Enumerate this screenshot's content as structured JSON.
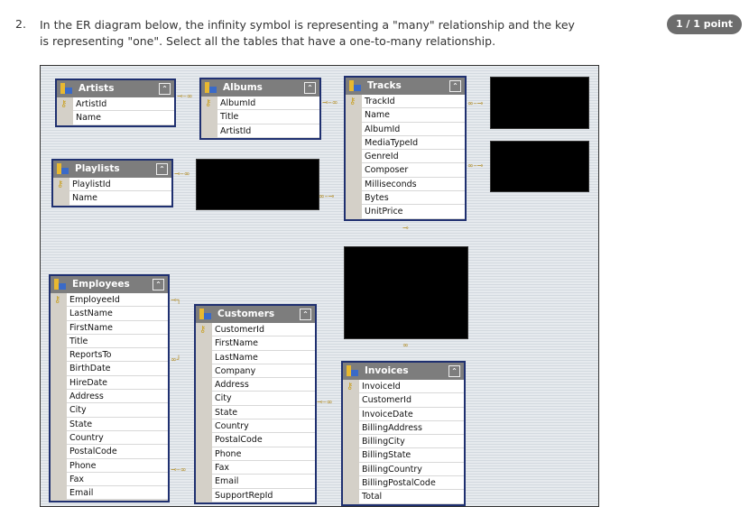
{
  "question": {
    "number": "2.",
    "text": "In the ER diagram below, the infinity symbol is representing a \"many\" relationship and the key is representing \"one\". Select all the tables that have a one-to-many relationship.",
    "score": "1 / 1 point"
  },
  "tables": {
    "artists": {
      "title": "Artists",
      "fields": [
        "ArtistId",
        "Name"
      ]
    },
    "albums": {
      "title": "Albums",
      "fields": [
        "AlbumId",
        "Title",
        "ArtistId"
      ]
    },
    "tracks": {
      "title": "Tracks",
      "fields": [
        "TrackId",
        "Name",
        "AlbumId",
        "MediaTypeId",
        "GenreId",
        "Composer",
        "Milliseconds",
        "Bytes",
        "UnitPrice"
      ]
    },
    "playlists": {
      "title": "Playlists",
      "fields": [
        "PlaylistId",
        "Name"
      ]
    },
    "employees": {
      "title": "Employees",
      "fields": [
        "EmployeeId",
        "LastName",
        "FirstName",
        "Title",
        "ReportsTo",
        "BirthDate",
        "HireDate",
        "Address",
        "City",
        "State",
        "Country",
        "PostalCode",
        "Phone",
        "Fax",
        "Email"
      ]
    },
    "customers": {
      "title": "Customers",
      "fields": [
        "CustomerId",
        "FirstName",
        "LastName",
        "Company",
        "Address",
        "City",
        "State",
        "Country",
        "PostalCode",
        "Phone",
        "Fax",
        "Email",
        "SupportRepId"
      ]
    },
    "invoices": {
      "title": "Invoices",
      "fields": [
        "InvoiceId",
        "CustomerId",
        "InvoiceDate",
        "BillingAddress",
        "BillingCity",
        "BillingState",
        "BillingCountry",
        "BillingPostalCode",
        "Total"
      ]
    }
  },
  "symbols": {
    "one": "key-icon",
    "many": "infinity-icon"
  },
  "colors": {
    "header": "#7d7d7d",
    "border": "#1f3070",
    "badge": "#6d6d6d"
  }
}
